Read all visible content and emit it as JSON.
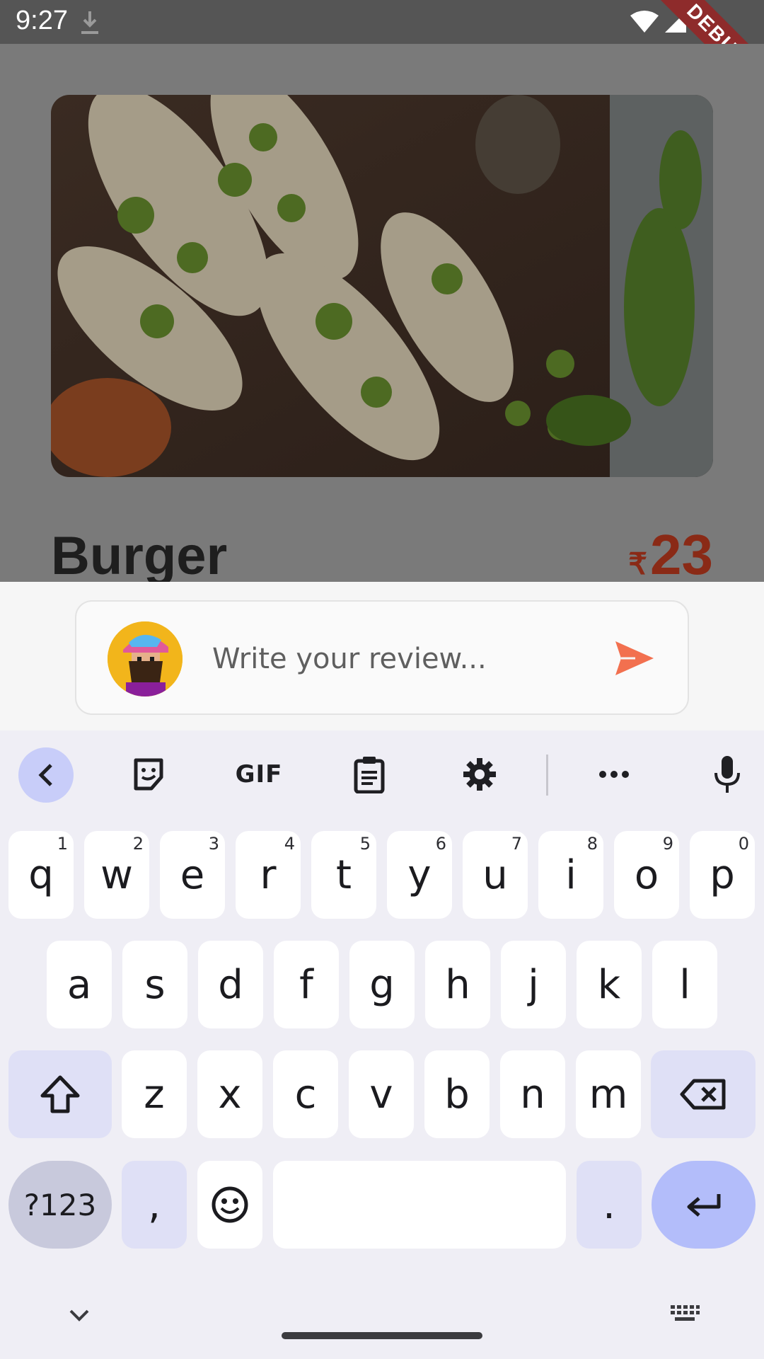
{
  "status": {
    "time": "9:27",
    "ribbon": "DEBUG"
  },
  "food": {
    "title": "Burger",
    "currency": "₹",
    "price": "23"
  },
  "review": {
    "placeholder": "Write your review..."
  },
  "keyboard": {
    "toolbar": {
      "gif": "GIF"
    },
    "row1": [
      {
        "k": "q",
        "h": "1"
      },
      {
        "k": "w",
        "h": "2"
      },
      {
        "k": "e",
        "h": "3"
      },
      {
        "k": "r",
        "h": "4"
      },
      {
        "k": "t",
        "h": "5"
      },
      {
        "k": "y",
        "h": "6"
      },
      {
        "k": "u",
        "h": "7"
      },
      {
        "k": "i",
        "h": "8"
      },
      {
        "k": "o",
        "h": "9"
      },
      {
        "k": "p",
        "h": "0"
      }
    ],
    "row2": [
      "a",
      "s",
      "d",
      "f",
      "g",
      "h",
      "j",
      "k",
      "l"
    ],
    "row3": [
      "z",
      "x",
      "c",
      "v",
      "b",
      "n",
      "m"
    ],
    "row4": {
      "symbols": "?123",
      "comma": ",",
      "period": "."
    }
  },
  "colors": {
    "accent": "#f2704f",
    "price": "#8a2a16",
    "keyboard_bg": "#efeef5"
  }
}
